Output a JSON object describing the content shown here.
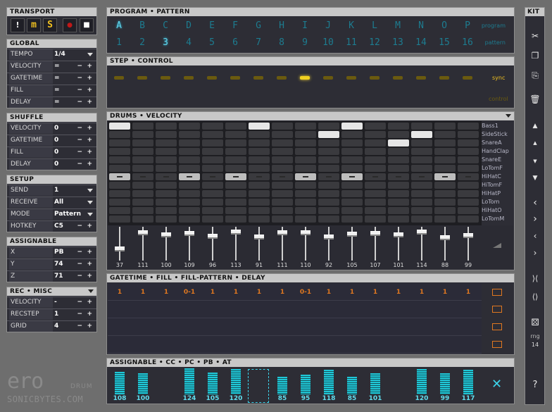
{
  "transport": {
    "title": "TRANSPORT",
    "buttons": [
      {
        "label": "!"
      },
      {
        "label": "m"
      },
      {
        "label": "S"
      },
      {
        "label": "●"
      },
      {
        "label": "■"
      }
    ]
  },
  "global": {
    "title": "GLOBAL",
    "rows": [
      {
        "label": "TEMPO",
        "value": "1/4",
        "kind": "dropdown"
      },
      {
        "label": "VELOCITY",
        "value": "=",
        "kind": "stepper"
      },
      {
        "label": "GATETIME",
        "value": "=",
        "kind": "stepper"
      },
      {
        "label": "FILL",
        "value": "=",
        "kind": "stepper"
      },
      {
        "label": "DELAY",
        "value": "=",
        "kind": "stepper"
      }
    ]
  },
  "shuffle": {
    "title": "SHUFFLE",
    "rows": [
      {
        "label": "VELOCITY",
        "value": "0"
      },
      {
        "label": "GATETIME",
        "value": "0"
      },
      {
        "label": "FILL",
        "value": "0"
      },
      {
        "label": "DELAY",
        "value": "0"
      }
    ]
  },
  "setup": {
    "title": "SETUP",
    "rows": [
      {
        "label": "SEND",
        "value": "1",
        "kind": "dropdown"
      },
      {
        "label": "RECEIVE",
        "value": "All",
        "kind": "dropdown"
      },
      {
        "label": "MODE",
        "value": "Pattern",
        "kind": "dropdown"
      },
      {
        "label": "HOTKEY",
        "value": "C5",
        "kind": "stepper"
      }
    ]
  },
  "assignable_left": {
    "title": "ASSIGNABLE",
    "rows": [
      {
        "label": "X",
        "value": "PB"
      },
      {
        "label": "Y",
        "value": "74"
      },
      {
        "label": "Z",
        "value": "71"
      }
    ]
  },
  "recmisc": {
    "title": "REC • MISC",
    "rows": [
      {
        "label": "VELOCITY",
        "value": "-"
      },
      {
        "label": "RECSTEP",
        "value": "1"
      },
      {
        "label": "GRID",
        "value": "4"
      }
    ]
  },
  "logo": {
    "line1": "ero",
    "drum": "DRUM",
    "line2": "SONICBYTES.COM"
  },
  "program_pattern": {
    "title": "PROGRAM • PATTERN",
    "program_label": "program",
    "pattern_label": "pattern",
    "programs": [
      "A",
      "B",
      "C",
      "D",
      "E",
      "F",
      "G",
      "H",
      "I",
      "J",
      "K",
      "L",
      "M",
      "N",
      "O",
      "P"
    ],
    "patterns": [
      "1",
      "2",
      "3",
      "4",
      "5",
      "6",
      "7",
      "8",
      "9",
      "10",
      "11",
      "12",
      "13",
      "14",
      "15",
      "16"
    ],
    "selected_program": 0,
    "selected_pattern": 2
  },
  "step_control": {
    "title": "STEP • CONTROL",
    "active_step": 8,
    "sync_label": "sync",
    "control_label": "control"
  },
  "drums": {
    "title": "DRUMS • VELOCITY",
    "instruments": [
      "Bass1",
      "SideStick",
      "SnareA",
      "HandClap",
      "SnareE",
      "LoTomF",
      "HiHatC",
      "HiTomF",
      "HiHatP",
      "LoTom",
      "HiHatO",
      "LoTomM"
    ],
    "hits": [
      [
        0,
        "on"
      ],
      [
        6,
        "on"
      ],
      [
        10,
        "on"
      ],
      [
        9,
        "on_row1"
      ],
      [
        13,
        "on_row1"
      ],
      [
        12,
        "on_row2"
      ]
    ],
    "fader_values": [
      "37",
      "111",
      "100",
      "109",
      "96",
      "113",
      "91",
      "111",
      "110",
      "92",
      "105",
      "107",
      "101",
      "114",
      "88",
      "99"
    ],
    "fader_levels": [
      0.29,
      0.87,
      0.79,
      0.86,
      0.76,
      0.89,
      0.72,
      0.87,
      0.87,
      0.72,
      0.83,
      0.84,
      0.8,
      0.9,
      0.69,
      0.78
    ]
  },
  "gatetime": {
    "title": "GATETIME • FILL • FILL-PATTERN • DELAY",
    "values": [
      "1",
      "1",
      "1",
      "0-1",
      "1",
      "1",
      "1",
      "1",
      "0-1",
      "1",
      "1",
      "1",
      "1",
      "1",
      "1",
      "1"
    ]
  },
  "assignable_bottom": {
    "title": "ASSIGNABLE • CC • PC • PB • AT",
    "values": [
      "108",
      "100",
      "",
      "124",
      "105",
      "120",
      "",
      "85",
      "95",
      "118",
      "85",
      "101",
      "",
      "120",
      "99",
      "117"
    ],
    "close_label": "✕"
  },
  "kit": {
    "title": "KIT",
    "rng_label": "rng",
    "rng_value": "14",
    "help": "?"
  }
}
